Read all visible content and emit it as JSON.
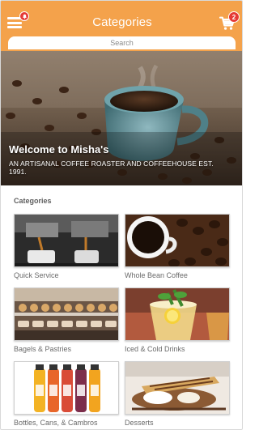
{
  "header": {
    "title": "Categories",
    "menu_icon": "hamburger-menu-icon",
    "notification_icon": "bell-icon",
    "cart_icon": "shopping-cart-icon",
    "cart_count": "2",
    "search_placeholder": "Search",
    "accent_color": "#f4a24b",
    "badge_color": "#e53935"
  },
  "hero": {
    "title": "Welcome to Misha's",
    "subtitle": "AN ARTISANAL COFFEE ROASTER AND COFFEEHOUSE EST. 1991."
  },
  "categories": {
    "heading": "Categories",
    "items": [
      {
        "label": "Quick Service"
      },
      {
        "label": "Whole Bean Coffee"
      },
      {
        "label": "Bagels & Pastries"
      },
      {
        "label": "Iced & Cold Drinks"
      },
      {
        "label": "Bottles, Cans, & Cambros"
      },
      {
        "label": "Desserts"
      }
    ]
  }
}
